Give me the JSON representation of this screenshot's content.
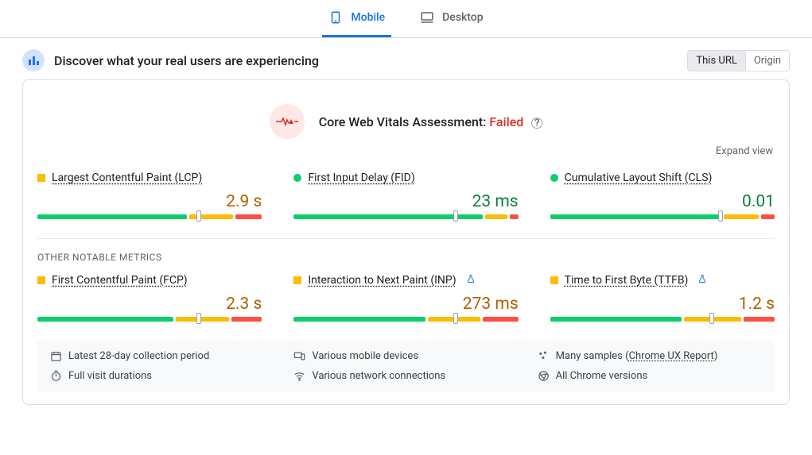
{
  "tabs": {
    "mobile": "Mobile",
    "desktop": "Desktop"
  },
  "header": {
    "title": "Discover what your real users are experiencing",
    "toggle": {
      "this_url": "This URL",
      "origin": "Origin"
    }
  },
  "assessment": {
    "label": "Core Web Vitals Assessment:",
    "status": "Failed"
  },
  "expand_view": "Expand view",
  "metrics": {
    "lcp": {
      "name": "Largest Contentful Paint (LCP)",
      "value": "2.9 s"
    },
    "fid": {
      "name": "First Input Delay (FID)",
      "value": "23 ms"
    },
    "cls": {
      "name": "Cumulative Layout Shift (CLS)",
      "value": "0.01"
    }
  },
  "other_label": "OTHER NOTABLE METRICS",
  "other_metrics": {
    "fcp": {
      "name": "First Contentful Paint (FCP)",
      "value": "2.3 s"
    },
    "inp": {
      "name": "Interaction to Next Paint (INP)",
      "value": "273 ms"
    },
    "ttfb": {
      "name": "Time to First Byte (TTFB)",
      "value": "1.2 s"
    }
  },
  "footer": {
    "period": "Latest 28-day collection period",
    "devices": "Various mobile devices",
    "samples_prefix": "Many samples (",
    "samples_link": "Chrome UX Report",
    "samples_suffix": ")",
    "duration": "Full visit durations",
    "network": "Various network connections",
    "versions": "All Chrome versions"
  }
}
